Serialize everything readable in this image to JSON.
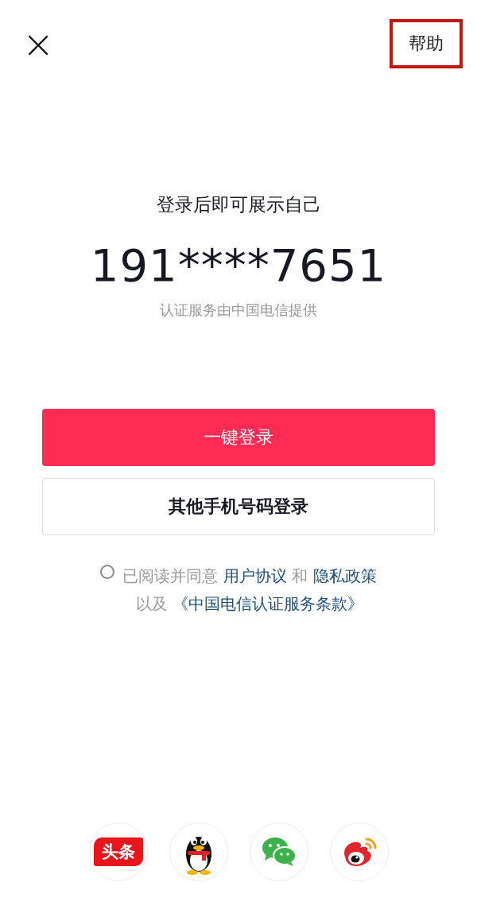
{
  "header": {
    "close": "×",
    "help": "帮助",
    "help_highlighted": true
  },
  "title": "登录后即可展示自己",
  "phone": "191****7651",
  "provider": "认证服务由中国电信提供",
  "primary_button": "一键登录",
  "secondary_button": "其他手机号码登录",
  "agreement": {
    "checked": false,
    "lines": [
      [
        {
          "text": "已阅读并同意 ",
          "link": false
        },
        {
          "text": "用户协议",
          "link": true
        },
        {
          "text": " 和 ",
          "link": false
        },
        {
          "text": "隐私政策",
          "link": true
        }
      ],
      [
        {
          "text": "以及 ",
          "link": false
        },
        {
          "text": "《中国电信认证服务条款》",
          "link": true
        }
      ]
    ]
  },
  "social": [
    {
      "kind": "toutiao",
      "label": "头条"
    },
    {
      "kind": "penguin"
    },
    {
      "kind": "chat"
    },
    {
      "kind": "weibo"
    }
  ]
}
